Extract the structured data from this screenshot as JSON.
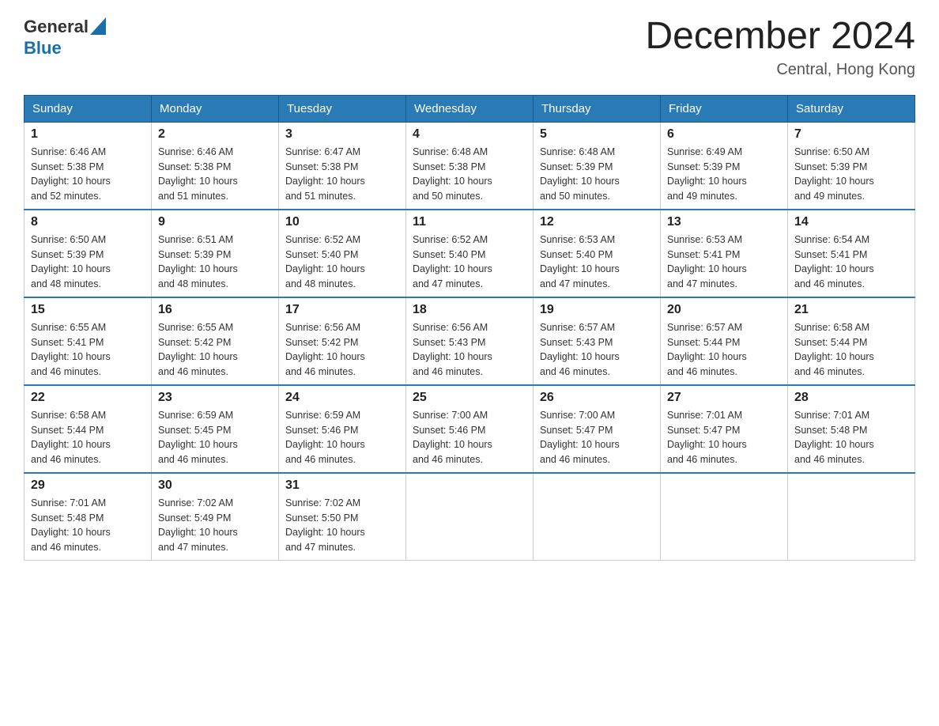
{
  "header": {
    "logo": {
      "general": "General",
      "blue": "Blue"
    },
    "title": "December 2024",
    "location": "Central, Hong Kong"
  },
  "weekdays": [
    "Sunday",
    "Monday",
    "Tuesday",
    "Wednesday",
    "Thursday",
    "Friday",
    "Saturday"
  ],
  "weeks": [
    [
      {
        "day": "1",
        "sunrise": "6:46 AM",
        "sunset": "5:38 PM",
        "daylight": "10 hours and 52 minutes."
      },
      {
        "day": "2",
        "sunrise": "6:46 AM",
        "sunset": "5:38 PM",
        "daylight": "10 hours and 51 minutes."
      },
      {
        "day": "3",
        "sunrise": "6:47 AM",
        "sunset": "5:38 PM",
        "daylight": "10 hours and 51 minutes."
      },
      {
        "day": "4",
        "sunrise": "6:48 AM",
        "sunset": "5:38 PM",
        "daylight": "10 hours and 50 minutes."
      },
      {
        "day": "5",
        "sunrise": "6:48 AM",
        "sunset": "5:39 PM",
        "daylight": "10 hours and 50 minutes."
      },
      {
        "day": "6",
        "sunrise": "6:49 AM",
        "sunset": "5:39 PM",
        "daylight": "10 hours and 49 minutes."
      },
      {
        "day": "7",
        "sunrise": "6:50 AM",
        "sunset": "5:39 PM",
        "daylight": "10 hours and 49 minutes."
      }
    ],
    [
      {
        "day": "8",
        "sunrise": "6:50 AM",
        "sunset": "5:39 PM",
        "daylight": "10 hours and 48 minutes."
      },
      {
        "day": "9",
        "sunrise": "6:51 AM",
        "sunset": "5:39 PM",
        "daylight": "10 hours and 48 minutes."
      },
      {
        "day": "10",
        "sunrise": "6:52 AM",
        "sunset": "5:40 PM",
        "daylight": "10 hours and 48 minutes."
      },
      {
        "day": "11",
        "sunrise": "6:52 AM",
        "sunset": "5:40 PM",
        "daylight": "10 hours and 47 minutes."
      },
      {
        "day": "12",
        "sunrise": "6:53 AM",
        "sunset": "5:40 PM",
        "daylight": "10 hours and 47 minutes."
      },
      {
        "day": "13",
        "sunrise": "6:53 AM",
        "sunset": "5:41 PM",
        "daylight": "10 hours and 47 minutes."
      },
      {
        "day": "14",
        "sunrise": "6:54 AM",
        "sunset": "5:41 PM",
        "daylight": "10 hours and 46 minutes."
      }
    ],
    [
      {
        "day": "15",
        "sunrise": "6:55 AM",
        "sunset": "5:41 PM",
        "daylight": "10 hours and 46 minutes."
      },
      {
        "day": "16",
        "sunrise": "6:55 AM",
        "sunset": "5:42 PM",
        "daylight": "10 hours and 46 minutes."
      },
      {
        "day": "17",
        "sunrise": "6:56 AM",
        "sunset": "5:42 PM",
        "daylight": "10 hours and 46 minutes."
      },
      {
        "day": "18",
        "sunrise": "6:56 AM",
        "sunset": "5:43 PM",
        "daylight": "10 hours and 46 minutes."
      },
      {
        "day": "19",
        "sunrise": "6:57 AM",
        "sunset": "5:43 PM",
        "daylight": "10 hours and 46 minutes."
      },
      {
        "day": "20",
        "sunrise": "6:57 AM",
        "sunset": "5:44 PM",
        "daylight": "10 hours and 46 minutes."
      },
      {
        "day": "21",
        "sunrise": "6:58 AM",
        "sunset": "5:44 PM",
        "daylight": "10 hours and 46 minutes."
      }
    ],
    [
      {
        "day": "22",
        "sunrise": "6:58 AM",
        "sunset": "5:44 PM",
        "daylight": "10 hours and 46 minutes."
      },
      {
        "day": "23",
        "sunrise": "6:59 AM",
        "sunset": "5:45 PM",
        "daylight": "10 hours and 46 minutes."
      },
      {
        "day": "24",
        "sunrise": "6:59 AM",
        "sunset": "5:46 PM",
        "daylight": "10 hours and 46 minutes."
      },
      {
        "day": "25",
        "sunrise": "7:00 AM",
        "sunset": "5:46 PM",
        "daylight": "10 hours and 46 minutes."
      },
      {
        "day": "26",
        "sunrise": "7:00 AM",
        "sunset": "5:47 PM",
        "daylight": "10 hours and 46 minutes."
      },
      {
        "day": "27",
        "sunrise": "7:01 AM",
        "sunset": "5:47 PM",
        "daylight": "10 hours and 46 minutes."
      },
      {
        "day": "28",
        "sunrise": "7:01 AM",
        "sunset": "5:48 PM",
        "daylight": "10 hours and 46 minutes."
      }
    ],
    [
      {
        "day": "29",
        "sunrise": "7:01 AM",
        "sunset": "5:48 PM",
        "daylight": "10 hours and 46 minutes."
      },
      {
        "day": "30",
        "sunrise": "7:02 AM",
        "sunset": "5:49 PM",
        "daylight": "10 hours and 47 minutes."
      },
      {
        "day": "31",
        "sunrise": "7:02 AM",
        "sunset": "5:50 PM",
        "daylight": "10 hours and 47 minutes."
      },
      null,
      null,
      null,
      null
    ]
  ],
  "labels": {
    "sunrise": "Sunrise:",
    "sunset": "Sunset:",
    "daylight": "Daylight:"
  }
}
